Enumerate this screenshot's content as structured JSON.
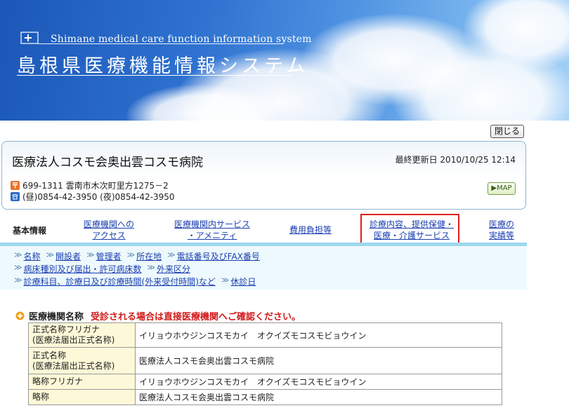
{
  "header": {
    "subtitle": "Shimane medical care function information system",
    "title": "島根県医療機能情報システム"
  },
  "close_button": "閉じる",
  "hospital": {
    "name": "医療法人コスモ会奥出雲コスモ病院",
    "updated": "最終更新日 2010/10/25 12:14",
    "address": "699-1311 雲南市木次町里方1275－2",
    "phone": "(昼)0854-42-3950 (夜)0854-42-3950",
    "map_label": "▶MAP"
  },
  "tabs": {
    "basic": "基本情報",
    "t1": [
      "医療機関への",
      "アクセス"
    ],
    "t2": [
      "医療機関内サービス",
      "・アメニティ"
    ],
    "t3": "費用負担等",
    "t4": [
      "診療内容、提供保健・",
      "医療・介護サービス"
    ],
    "t5": [
      "医療の",
      "実績等"
    ]
  },
  "sublinks": {
    "row1": [
      "名称",
      "開設者",
      "管理者",
      "所在地",
      "電話番号及びFAX番号"
    ],
    "row2": [
      "病床種別及び届出・許可病床数",
      "外来区分"
    ],
    "row3": [
      "診療科目、診療日及び診療時間(外来受付時間)など",
      "休診日"
    ]
  },
  "section": {
    "title": "医療機関名称",
    "note": "受診される場合は直接医療機関へご確認ください。"
  },
  "table": [
    {
      "label": [
        "正式名称フリガナ",
        "(医療法届出正式名称)"
      ],
      "value": "イリョウホウジンコスモカイ　オクイズモコスモビョウイン"
    },
    {
      "label": [
        "正式名称",
        "(医療法届出正式名称)"
      ],
      "value": "医療法人コスモ会奥出雲コスモ病院"
    },
    {
      "label": [
        "略称フリガナ"
      ],
      "value": "イリョウホウジンコスモカイ　オクイズモコスモビョウイン"
    },
    {
      "label": [
        "略称"
      ],
      "value": "医療法人コスモ会奥出雲コスモ病院"
    }
  ],
  "colors": {
    "link": "#1a3fb0",
    "note_red": "#d21a1a",
    "tab_bar": "#9dd8ee",
    "highlight_box": "#e02020"
  }
}
